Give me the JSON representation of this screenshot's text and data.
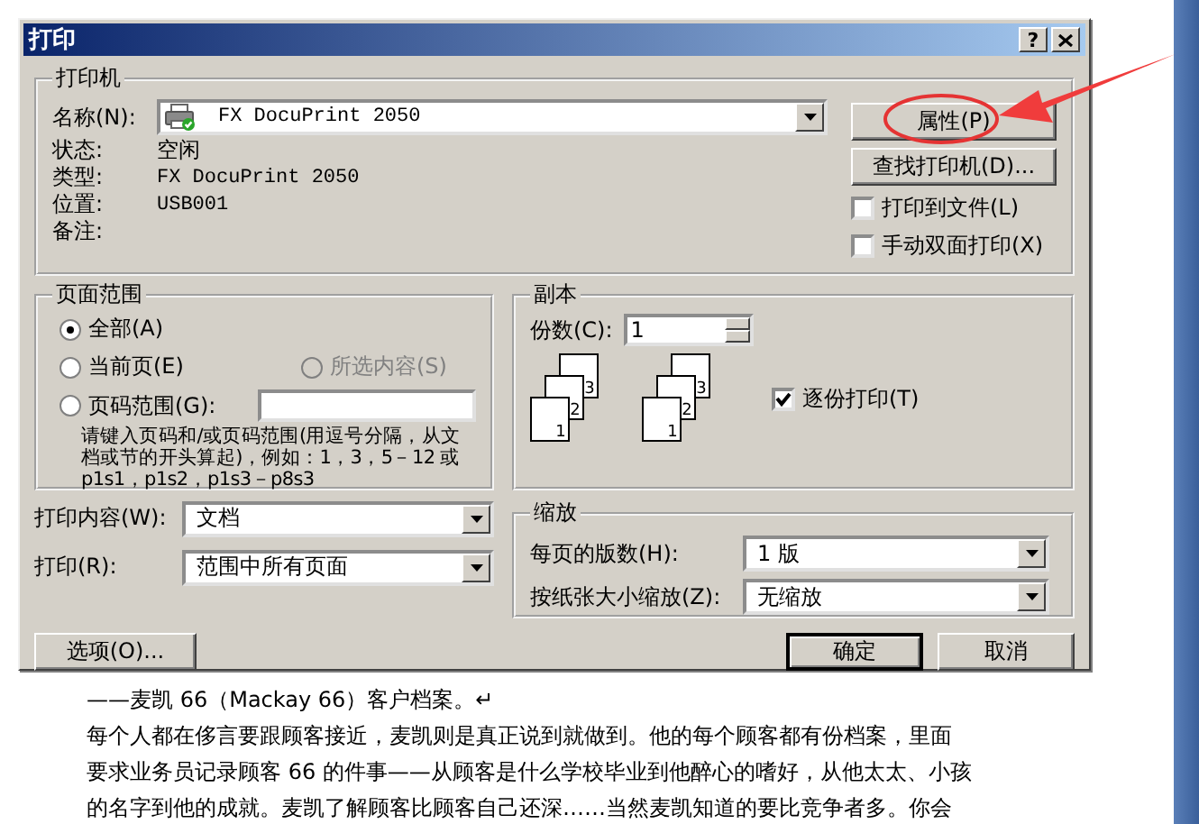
{
  "window": {
    "title": "打印",
    "help_button": "?"
  },
  "printer": {
    "title": "打印机",
    "name_label": "名称(N):",
    "name_value": "FX DocuPrint 2050",
    "info": [
      {
        "label": "状态:",
        "value": "空闲"
      },
      {
        "label": "类型:",
        "value": "FX DocuPrint 2050"
      },
      {
        "label": "位置:",
        "value": "USB001"
      },
      {
        "label": "备注:"
      }
    ],
    "buttons": [
      "属性(P)",
      "查找打印机(D)..."
    ],
    "options": [
      {
        "label": "打印到文件(L)",
        "checked": false
      },
      {
        "label": "手动双面打印(X)",
        "checked": false
      }
    ]
  },
  "page_range": {
    "title": "页面范围",
    "radios": [
      {
        "label": "全部(A)",
        "selected": true,
        "disabled": false
      },
      {
        "label": "当前页(E)",
        "selected": false,
        "disabled": false
      },
      {
        "label": "所选内容(S)",
        "selected": false,
        "disabled": true
      },
      {
        "label": "页码范围(G):",
        "selected": false,
        "disabled": false
      }
    ],
    "hint": "请键入页码和/或页码范围(用逗号分隔，从文档或节的开头算起)，例如：1，3，5－12 或 p1s1，p1s2，p1s3－p8s3"
  },
  "copies": {
    "title": "副本",
    "count_label": "份数(C):",
    "count_value": "1",
    "uncollated_pages": [
      "1",
      "2",
      "3"
    ],
    "collated_pages": [
      "1",
      "2",
      "3"
    ],
    "collate": {
      "label": "逐份打印(T)",
      "checked": true
    }
  },
  "print_what": {
    "label": "打印内容(W):",
    "value": "文档"
  },
  "print": {
    "label": "打印(R):",
    "value": "范围中所有页面"
  },
  "zoom": {
    "title": "缩放",
    "rows": [
      {
        "label": "每页的版数(H):",
        "value": "1 版"
      },
      {
        "label": "按纸张大小缩放(Z):",
        "value": "无缩放"
      }
    ]
  },
  "buttons": {
    "options": "选项(O)...",
    "ok": "确定",
    "cancel": "取消"
  },
  "document": {
    "lines": [
      "——麦凯 66（Mackay 66）客户档案。↵",
      "每个人都在侈言要跟顾客接近，麦凯则是真正说到就做到。他的每个顾客都有份档案，里面",
      "要求业务员记录顾客 66 的件事——从顾客是什么学校毕业到他醉心的嗜好，从他太太、小孩",
      "的名字到他的成就。麦凯了解顾客比顾客自己还深……当然麦凯知道的要比竞争者多。你会"
    ]
  }
}
